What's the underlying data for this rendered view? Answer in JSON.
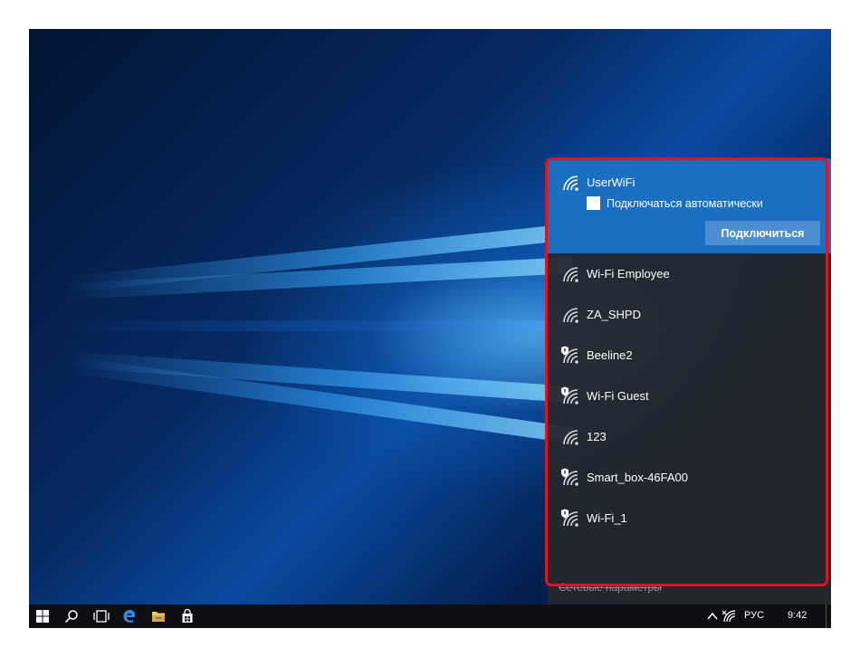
{
  "wifi_panel": {
    "connected_network": {
      "name": "UserWiFi",
      "auto_connect_label": "Подключаться автоматически",
      "auto_connect_checked": false,
      "connect_button_label": "Подключиться"
    },
    "networks": [
      {
        "name": "Wi-Fi Employee",
        "secured": false
      },
      {
        "name": "ZA_SHPD",
        "secured": false
      },
      {
        "name": "Beeline2",
        "secured": true
      },
      {
        "name": "Wi-Fi Guest",
        "secured": true
      },
      {
        "name": "123",
        "secured": false
      },
      {
        "name": "Smart_box-46FA00",
        "secured": true
      },
      {
        "name": "Wi-Fi_1",
        "secured": true
      }
    ],
    "settings_link": "Сетевые параметры"
  },
  "taskbar": {
    "language": "РУС",
    "time": "9:42"
  },
  "colors": {
    "accent": "#1a6fc2",
    "panel_bg": "#24282e",
    "highlight": "#e2131e",
    "taskbar": "#0e0f12"
  }
}
